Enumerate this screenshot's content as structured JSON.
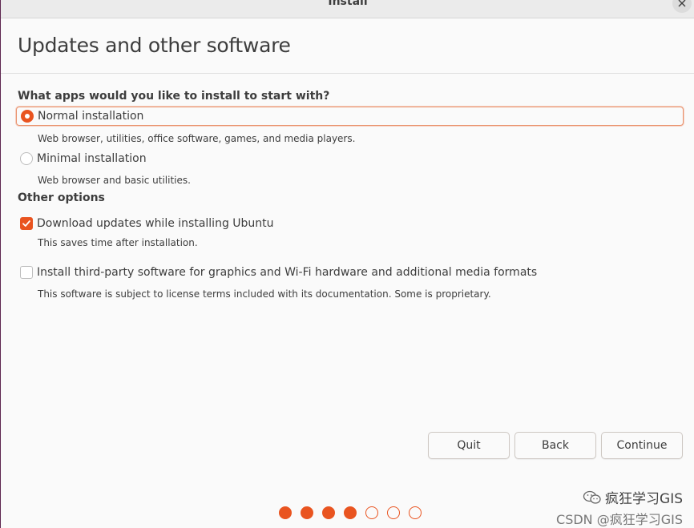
{
  "window": {
    "title": "Install"
  },
  "header": {
    "title": "Updates and other software"
  },
  "install_type": {
    "heading": "What apps would you like to install to start with?",
    "options": [
      {
        "label": "Normal installation",
        "description": "Web browser, utilities, office software, games, and media players.",
        "selected": true
      },
      {
        "label": "Minimal installation",
        "description": "Web browser and basic utilities.",
        "selected": false
      }
    ]
  },
  "other_options": {
    "heading": "Other options",
    "items": [
      {
        "label": "Download updates while installing Ubuntu",
        "description": "This saves time after installation.",
        "checked": true
      },
      {
        "label": "Install third-party software for graphics and Wi-Fi hardware and additional media formats",
        "description": "This software is subject to license terms included with its documentation. Some is proprietary.",
        "checked": false
      }
    ]
  },
  "buttons": {
    "quit": "Quit",
    "back": "Back",
    "continue": "Continue"
  },
  "progress": {
    "total_steps": 7,
    "completed_steps": 4
  },
  "watermark": {
    "line1": "疯狂学习GIS",
    "line2": "CSDN @疯狂学习GIS"
  },
  "colors": {
    "accent": "#e95420",
    "text": "#3d3d3d",
    "background": "#fafafa"
  },
  "icons": {
    "close": "close-icon",
    "check": "check-icon",
    "wechat": "wechat-icon"
  }
}
